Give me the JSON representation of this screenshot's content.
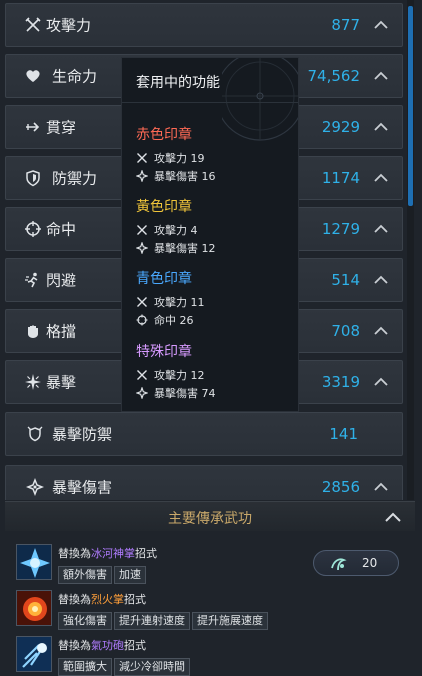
{
  "colors": {
    "value_blue": "#2fb1e8",
    "red_seal": "#ff6a55",
    "yellow_seal": "#f0c53a",
    "blue_seal": "#4aa9ff",
    "special_seal": "#d79bff",
    "section_gold": "#c9a86a"
  },
  "stats": [
    {
      "label": "攻擊力",
      "value": "877",
      "icon": "crossed-swords-icon"
    },
    {
      "label": "生命力",
      "value": "74,562",
      "icon": "heart-icon"
    },
    {
      "label": "貫穿",
      "value": "2929",
      "icon": "pierce-arrow-icon"
    },
    {
      "label": "防禦力",
      "value": "1174",
      "icon": "shield-icon"
    },
    {
      "label": "命中",
      "value": "1279",
      "icon": "crosshair-icon"
    },
    {
      "label": "閃避",
      "value": "514",
      "icon": "dodge-runner-icon"
    },
    {
      "label": "格擋",
      "value": "708",
      "icon": "block-fist-icon"
    },
    {
      "label": "暴擊",
      "value": "3319",
      "icon": "critical-burst-icon"
    },
    {
      "label": "暴擊防禦",
      "value": "141",
      "icon": "critical-defense-icon"
    },
    {
      "label": "暴擊傷害",
      "value": "2856",
      "icon": "critical-damage-icon"
    }
  ],
  "tooltip": {
    "title": "套用中的功能",
    "seals": [
      {
        "title": "赤色印章",
        "lines": [
          {
            "icon": "crossed-swords-icon",
            "text": "攻擊力 19"
          },
          {
            "icon": "critical-damage-icon",
            "text": "暴擊傷害 16"
          }
        ]
      },
      {
        "title": "黃色印章",
        "lines": [
          {
            "icon": "crossed-swords-icon",
            "text": "攻擊力 4"
          },
          {
            "icon": "critical-damage-icon",
            "text": "暴擊傷害 12"
          }
        ]
      },
      {
        "title": "青色印章",
        "lines": [
          {
            "icon": "crossed-swords-icon",
            "text": "攻擊力 11"
          },
          {
            "icon": "crosshair-icon",
            "text": "命中 26"
          }
        ]
      },
      {
        "title": "特殊印章",
        "lines": [
          {
            "icon": "crossed-swords-icon",
            "text": "攻擊力 12"
          },
          {
            "icon": "critical-damage-icon",
            "text": "暴擊傷害 74"
          }
        ]
      }
    ]
  },
  "section": {
    "title": "主要傳承武功"
  },
  "skills": [
    {
      "prefix": "替換為",
      "name": "冰河神掌",
      "suffix": "招式",
      "tags": [
        "額外傷害",
        "加速"
      ],
      "icon": "ice-palm-icon"
    },
    {
      "prefix": "替換為",
      "name": "烈火掌",
      "suffix": "招式",
      "tags": [
        "強化傷害",
        "提升連射速度",
        "提升施展速度"
      ],
      "icon": "fire-palm-icon"
    },
    {
      "prefix": "替換為",
      "name": "氣功砲",
      "suffix": "招式",
      "tags": [
        "範圍擴大",
        "減少冷卻時間"
      ],
      "icon": "qigong-cannon-icon"
    }
  ],
  "points": {
    "value": "20",
    "icon": "lineage-emblem-icon"
  }
}
